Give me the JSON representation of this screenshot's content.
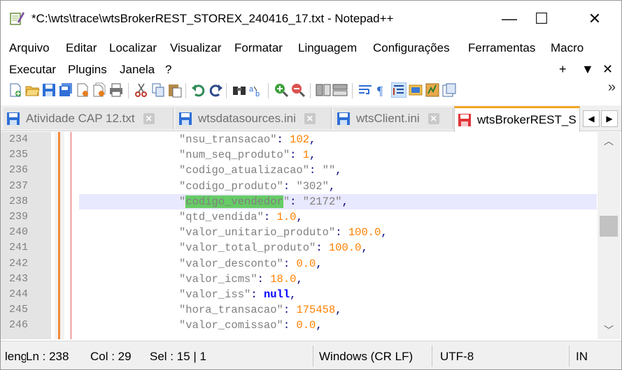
{
  "window": {
    "title": "*C:\\wts\\trace\\wtsBrokerREST_STOREX_240416_17.txt - Notepad++",
    "minimize": "—",
    "maximize": "☐",
    "close": "✕"
  },
  "menu": {
    "row1": [
      "Arquivo",
      "Editar",
      "Localizar",
      "Visualizar",
      "Formatar",
      "Linguagem",
      "Configurações",
      "Ferramentas",
      "Macro"
    ],
    "row2": [
      "Executar",
      "Plugins",
      "Janela",
      "?"
    ],
    "right_controls": [
      "+",
      "▼",
      "✕"
    ]
  },
  "toolbar": {
    "icons": [
      "new-file-icon",
      "open-file-icon",
      "save-icon",
      "save-all-icon",
      "close-icon",
      "close-all-icon",
      "print-icon",
      "cut-icon",
      "copy-icon",
      "paste-icon",
      "undo-icon",
      "redo-icon",
      "find-icon",
      "replace-icon",
      "zoom-in-icon",
      "zoom-out-icon",
      "sync-vertical-icon",
      "sync-horizontal-icon",
      "word-wrap-icon",
      "show-all-chars-icon",
      "indent-guide-icon",
      "doc-map-icon",
      "function-list-icon",
      "folder-workspace-icon"
    ],
    "more": "»"
  },
  "tabs": [
    {
      "label": "Atividade CAP 12.txt",
      "active": false
    },
    {
      "label": "wtsdatasources.ini",
      "active": false
    },
    {
      "label": "wtsClient.ini",
      "active": false
    },
    {
      "label": "wtsBrokerREST_S",
      "active": true
    }
  ],
  "tab_nav": {
    "left": "◀",
    "right": "▶"
  },
  "editor": {
    "current_line": 238,
    "lines": [
      {
        "num": "234",
        "key": "\"nsu_transacao\"",
        "val": "102",
        "val_type": "num",
        "end": ","
      },
      {
        "num": "235",
        "key": "\"num_seq_produto\"",
        "val": "1",
        "val_type": "num",
        "end": ","
      },
      {
        "num": "236",
        "key": "\"codigo_atualizacao\"",
        "val": "\"\"",
        "val_type": "str",
        "end": ","
      },
      {
        "num": "237",
        "key": "\"codigo_produto\"",
        "val": "\"302\"",
        "val_type": "str",
        "end": ","
      },
      {
        "num": "238",
        "key": "\"codigo_vendedor\"",
        "val": "\"2172\"",
        "val_type": "str",
        "end": ","
      },
      {
        "num": "239",
        "key": "\"qtd_vendida\"",
        "val": "1.0",
        "val_type": "num",
        "end": ","
      },
      {
        "num": "240",
        "key": "\"valor_unitario_produto\"",
        "val": "100.0",
        "val_type": "num",
        "end": ","
      },
      {
        "num": "241",
        "key": "\"valor_total_produto\"",
        "val": "100.0",
        "val_type": "num",
        "end": ","
      },
      {
        "num": "242",
        "key": "\"valor_desconto\"",
        "val": "0.0",
        "val_type": "num",
        "end": ","
      },
      {
        "num": "243",
        "key": "\"valor_icms\"",
        "val": "18.0",
        "val_type": "num",
        "end": ","
      },
      {
        "num": "244",
        "key": "\"valor_iss\"",
        "val": "null",
        "val_type": "kw",
        "end": ","
      },
      {
        "num": "245",
        "key": "\"hora_transacao\"",
        "val": "175458",
        "val_type": "num",
        "end": ","
      },
      {
        "num": "246",
        "key": "\"valor_comissao\"",
        "val": "0.0",
        "val_type": "num",
        "end": ","
      }
    ],
    "selection_text": "codigo_vendedor"
  },
  "status": {
    "lang": "leng",
    "ln": "Ln : 238",
    "col": "Col : 29",
    "sel": "Sel : 15 | 1",
    "eol": "Windows (CR LF)",
    "encoding": "UTF-8",
    "mode": "IN"
  },
  "colors": {
    "accent_tab": "#f5a623",
    "selection": "#66cc66",
    "current_line": "#e8e8ff",
    "number": "#ff8000",
    "keyword": "#0000ff"
  }
}
